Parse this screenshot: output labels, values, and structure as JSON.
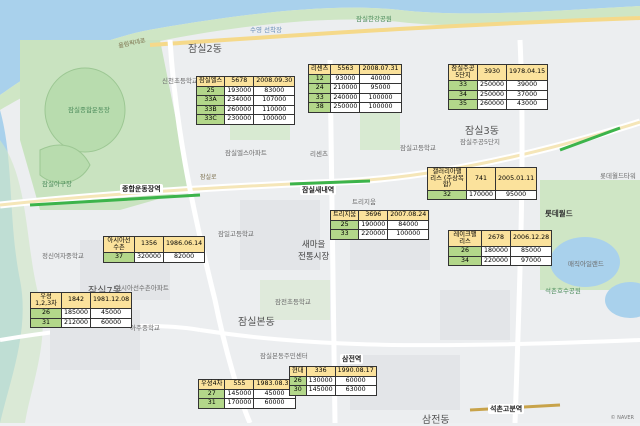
{
  "map_labels": {
    "districts": [
      "잠실2동",
      "잠실7동",
      "잠실본동",
      "잠실3동",
      "삼전동"
    ],
    "parks": [
      "수영 선착장",
      "잠실한강공원",
      "잠실종합운동장",
      "잠실아구장",
      "잠실근린공원",
      "석촌호수공원"
    ],
    "roads": [
      "올림픽대로",
      "잠실로",
      "RWE호"
    ],
    "stations": [
      "종합운동장역",
      "잠실새내역",
      "석촌고분역",
      "삼전역"
    ],
    "places": [
      "새마을\n전통시장",
      "롯데월드",
      "롯데월드타워",
      "매직아일랜드",
      "신천초등학교",
      "정신여자중학교",
      "잠일고등학교",
      "잠실고등학교",
      "아주중학교",
      "잠전초등학교",
      "잠실엘스아파트",
      "리센츠",
      "잠실주공5단지",
      "트리지움",
      "레이크팰리스",
      "갤러리아팰리스",
      "아시아선수촌아파트",
      "석촌호수",
      "잠실본동주민센터",
      "잠실레이크팰리스아파트"
    ],
    "attribution": "© NAVER"
  },
  "apartments": [
    {
      "name": "잠실엘스",
      "households": "5678",
      "date": "2008.09.30",
      "rows": [
        {
          "size": "25",
          "sale": "193000",
          "jeonse": "83000"
        },
        {
          "size": "33A",
          "sale": "234000",
          "jeonse": "107000"
        },
        {
          "size": "33B",
          "sale": "260000",
          "jeonse": "110000"
        },
        {
          "size": "33C",
          "sale": "230000",
          "jeonse": "100000"
        }
      ]
    },
    {
      "name": "리센츠",
      "households": "5563",
      "date": "2008.07.31",
      "rows": [
        {
          "size": "12",
          "sale": "93000",
          "jeonse": "40000"
        },
        {
          "size": "24",
          "sale": "210000",
          "jeonse": "95000"
        },
        {
          "size": "33",
          "sale": "240000",
          "jeonse": "100000"
        },
        {
          "size": "38",
          "sale": "250000",
          "jeonse": "100000"
        }
      ]
    },
    {
      "name": "잠실주공5단지",
      "households": "3930",
      "date": "1978.04.15",
      "rows": [
        {
          "size": "33",
          "sale": "250000",
          "jeonse": "39000"
        },
        {
          "size": "34",
          "sale": "250000",
          "jeonse": "37000"
        },
        {
          "size": "35",
          "sale": "260000",
          "jeonse": "43000"
        }
      ]
    },
    {
      "name": "갤러리아팰리스 (주상복합)",
      "households": "741",
      "date": "2005.01.11",
      "rows": [
        {
          "size": "32",
          "sale": "170000",
          "jeonse": "95000"
        }
      ]
    },
    {
      "name": "트리지움",
      "households": "3696",
      "date": "2007.08.24",
      "rows": [
        {
          "size": "25",
          "sale": "190000",
          "jeonse": "84000"
        },
        {
          "size": "33",
          "sale": "220000",
          "jeonse": "100000"
        }
      ]
    },
    {
      "name": "레이크팰리스",
      "households": "2678",
      "date": "2006.12.28",
      "rows": [
        {
          "size": "26",
          "sale": "180000",
          "jeonse": "85000"
        },
        {
          "size": "34",
          "sale": "220000",
          "jeonse": "97000"
        }
      ]
    },
    {
      "name": "아시아선수촌",
      "households": "1356",
      "date": "1986.06.14",
      "rows": [
        {
          "size": "37",
          "sale": "320000",
          "jeonse": "82000"
        }
      ]
    },
    {
      "name": "우성1,2,3차",
      "households": "1842",
      "date": "1981.12.08",
      "rows": [
        {
          "size": "26",
          "sale": "185000",
          "jeonse": "45000"
        },
        {
          "size": "31",
          "sale": "212000",
          "jeonse": "60000"
        }
      ]
    },
    {
      "name": "우성4차",
      "households": "555",
      "date": "1983.08.31",
      "rows": [
        {
          "size": "27",
          "sale": "145000",
          "jeonse": "45000"
        },
        {
          "size": "31",
          "sale": "170000",
          "jeonse": "60000"
        }
      ]
    },
    {
      "name": "현대",
      "households": "336",
      "date": "1990.08.17",
      "rows": [
        {
          "size": "26",
          "sale": "130000",
          "jeonse": "60000"
        },
        {
          "size": "30",
          "sale": "145000",
          "jeonse": "63000"
        }
      ]
    }
  ]
}
